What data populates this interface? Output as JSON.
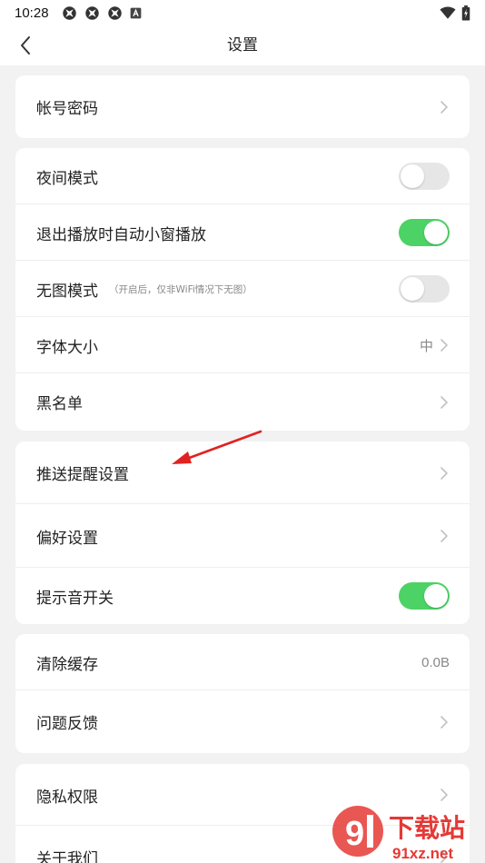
{
  "status_bar": {
    "time": "10:28",
    "icons": [
      "app-icon",
      "app-icon",
      "app-icon",
      "notification-a-icon"
    ],
    "right_icons": [
      "wifi-icon",
      "battery-icon"
    ]
  },
  "nav": {
    "title": "设置",
    "back_icon": "chevron-left-icon"
  },
  "groups": [
    {
      "items": [
        {
          "label": "帐号密码",
          "control": "chevron"
        }
      ]
    },
    {
      "items": [
        {
          "label": "夜间模式",
          "control": "toggle",
          "on": false
        },
        {
          "label": "退出播放时自动小窗播放",
          "control": "toggle",
          "on": true
        },
        {
          "label": "无图模式",
          "sub": "（开启后，仅非WiFi情况下无图）",
          "control": "toggle",
          "on": false
        },
        {
          "label": "字体大小",
          "value": "中",
          "control": "chevron"
        },
        {
          "label": "黑名单",
          "control": "chevron"
        }
      ]
    },
    {
      "items": [
        {
          "label": "推送提醒设置",
          "control": "chevron"
        },
        {
          "label": "偏好设置",
          "control": "chevron"
        },
        {
          "label": "提示音开关",
          "control": "toggle",
          "on": true
        }
      ]
    },
    {
      "items": [
        {
          "label": "清除缓存",
          "value": "0.0B",
          "control": "none"
        },
        {
          "label": "问题反馈",
          "control": "chevron"
        }
      ]
    },
    {
      "items": [
        {
          "label": "隐私权限",
          "control": "chevron"
        },
        {
          "label": "关于我们",
          "control": "chevron"
        }
      ]
    }
  ],
  "colors": {
    "toggle_on": "#4cd265",
    "toggle_off": "#e6e6e6",
    "annotation_arrow": "#e02222",
    "background": "#f2f2f2"
  },
  "watermark": {
    "text": "下载站",
    "url": "91xz.net"
  }
}
